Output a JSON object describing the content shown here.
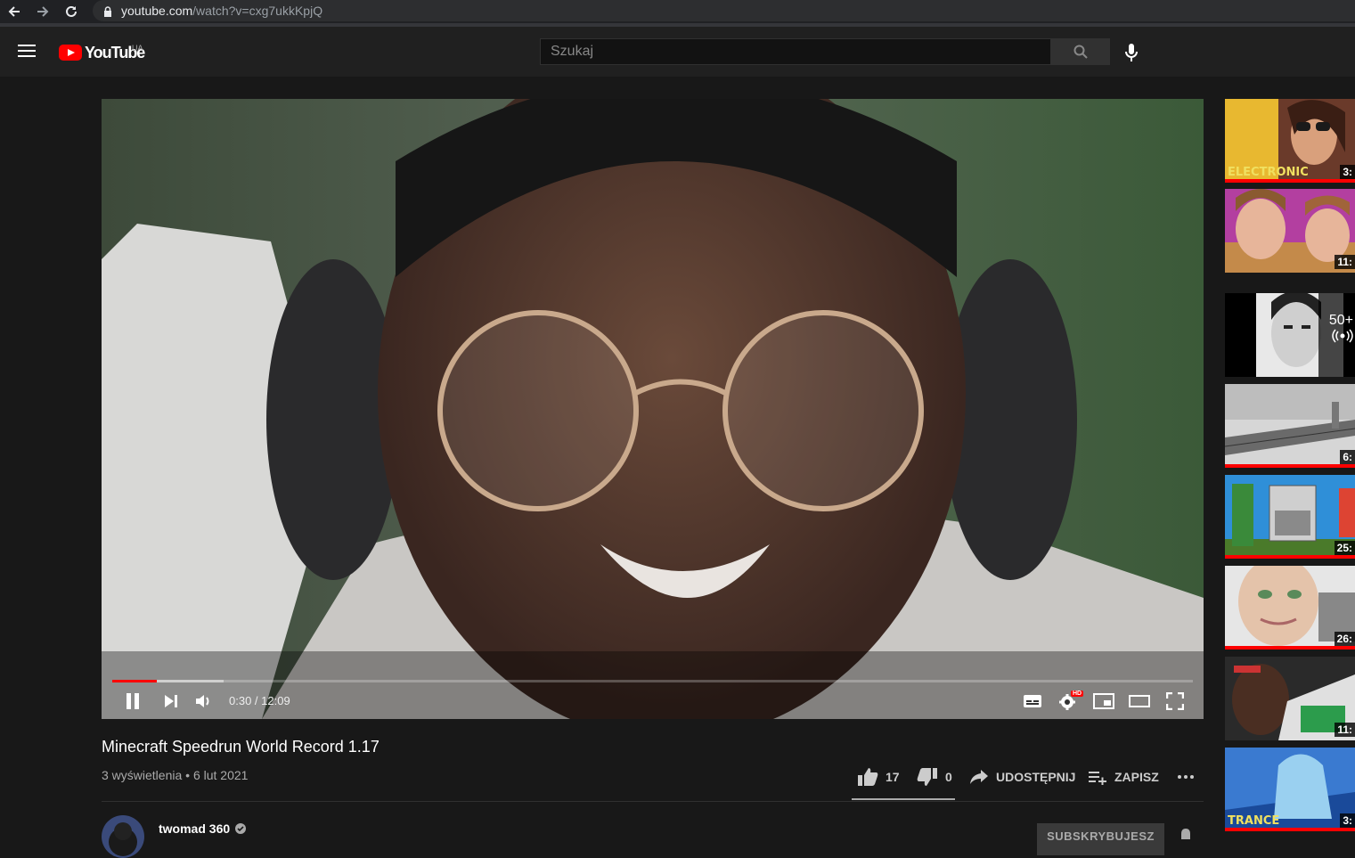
{
  "browser": {
    "url_domain": "youtube.com",
    "url_rest": "/watch?v=cxg7ukkKpjQ"
  },
  "header": {
    "logo_text": "YouTube",
    "country_code": "UA",
    "search_placeholder": "Szukaj"
  },
  "player": {
    "time_current": "0:30",
    "time_total": "12:09",
    "time_display": "0:30 / 12:09",
    "progress_fraction": 0.041,
    "buffer_fraction": 0.103,
    "hd_badge": "HD"
  },
  "video": {
    "title": "Minecraft Speedrun World Record 1.17",
    "meta": "3 wyświetlenia • 6 lut 2021",
    "likes": "17",
    "dislikes": "0",
    "share_label": "UDOSTĘPNIJ",
    "save_label": "ZAPISZ"
  },
  "channel": {
    "name": "twomad 360",
    "subscribe_label": "SUBSKRYBUJESZ"
  },
  "sidebar": {
    "items": [
      {
        "duration": "3:",
        "label": "ELECTRONIC",
        "watched": true
      },
      {
        "duration": "11:",
        "label": "",
        "watched": false
      },
      {
        "duration": "",
        "label": "",
        "badge": "50+",
        "live": true
      },
      {
        "duration": "6:",
        "label": "",
        "watched": true
      },
      {
        "duration": "25:",
        "label": "",
        "watched": true
      },
      {
        "duration": "26:",
        "label": "",
        "watched": true
      },
      {
        "duration": "11:",
        "label": "",
        "watched": false
      },
      {
        "duration": "3:",
        "label": "TRANCE",
        "watched": true
      }
    ]
  },
  "colors": {
    "brand_red": "#ff0000",
    "background": "#181818",
    "header": "#202020"
  }
}
